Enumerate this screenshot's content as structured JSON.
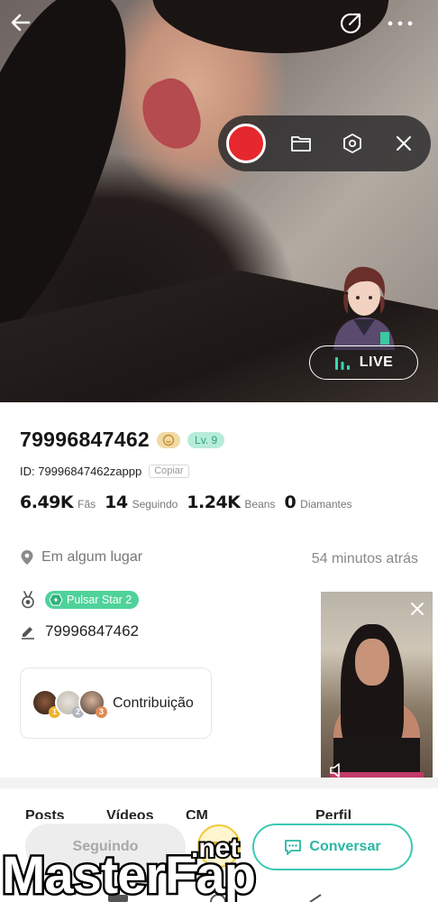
{
  "hero": {
    "live_label": "LIVE"
  },
  "profile": {
    "username": "79996847462",
    "level": "Lv. 9",
    "id_text": "ID: 79996847462zappp",
    "copy_label": "Copiar",
    "stats": [
      {
        "value": "6.49K",
        "label": "Fãs"
      },
      {
        "value": "14",
        "label": "Seguindo"
      },
      {
        "value": "1.24K",
        "label": "Beans"
      },
      {
        "value": "0",
        "label": "Diamantes"
      }
    ],
    "location": "Em algum lugar",
    "last_seen": "54 minutos atrás",
    "medal_label": "Pulsar Star 2",
    "bio": "79996847462",
    "contribution_label": "Contribuição",
    "contributor_ranks": [
      "1",
      "2",
      "3"
    ]
  },
  "tabs": [
    "Posts",
    "Vídeos",
    "CM",
    "Perfil"
  ],
  "actions": {
    "follow_label": "Seguindo",
    "chat_label": "Conversar"
  },
  "watermark": {
    "text": "MasterFap",
    "suffix": ".net"
  },
  "colors": {
    "record_red": "#e5282d",
    "level_green": "#2aa37a",
    "pulsar_green": "#4fd29a",
    "chat_teal": "#2bb7a3"
  },
  "icons": {
    "back": "arrow-left-icon",
    "share": "share-icon",
    "more": "more-dots-icon",
    "record": "record-icon",
    "folder": "folder-icon",
    "settings": "hexagon-settings-icon",
    "close": "close-icon",
    "live_bars": "live-bars-icon",
    "location": "location-pin-icon",
    "medal": "medal-icon",
    "edit": "pencil-icon",
    "chat": "chat-bubble-icon",
    "gift": "gift-icon"
  }
}
